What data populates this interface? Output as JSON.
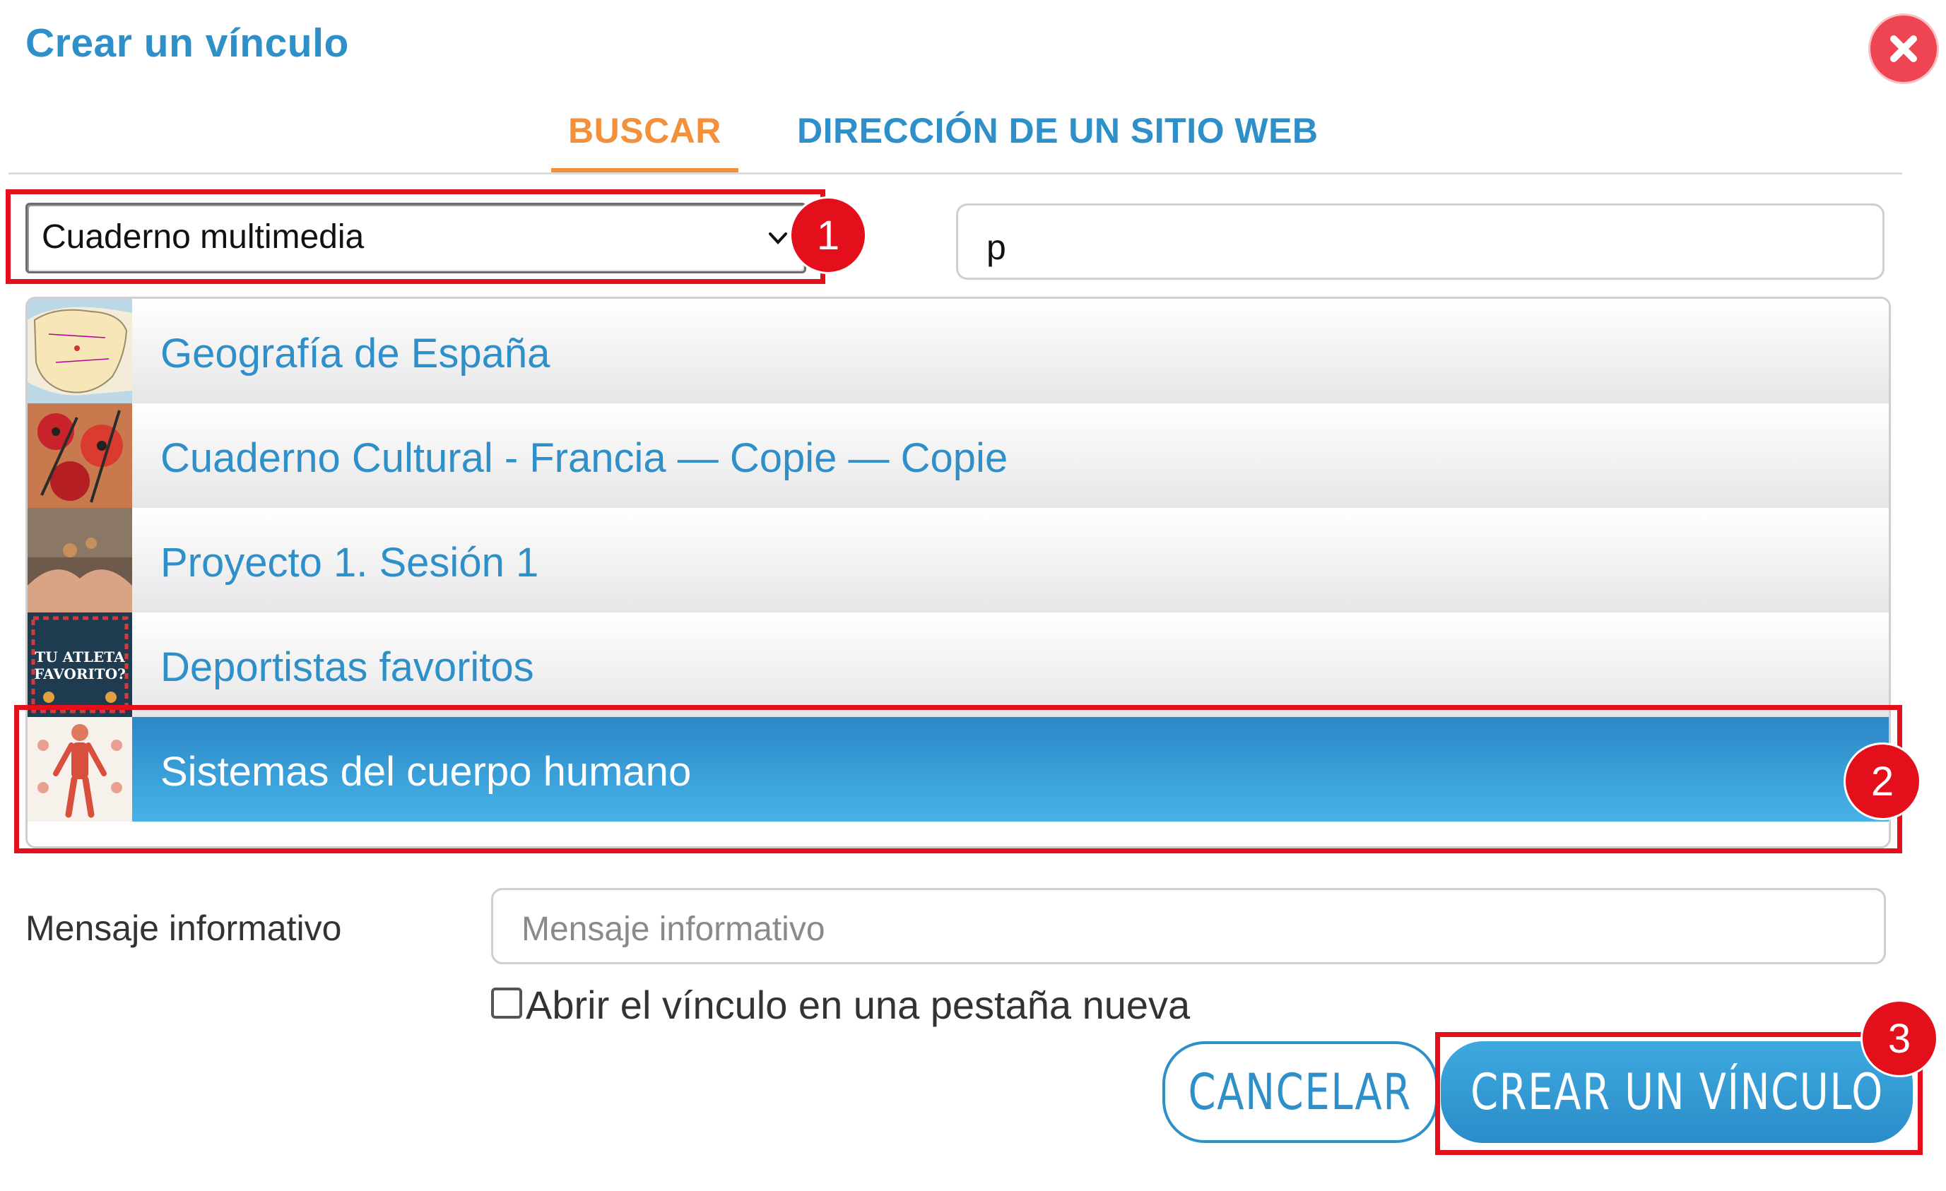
{
  "dialog": {
    "title": "Crear un vínculo",
    "close_icon": "close-icon"
  },
  "tabs": [
    {
      "label": "BUSCAR",
      "active": true
    },
    {
      "label": "DIRECCIÓN DE UN SITIO WEB",
      "active": false
    }
  ],
  "filter": {
    "selected": "Cuaderno multimedia"
  },
  "search": {
    "value": "p"
  },
  "results": [
    {
      "title": "Geografía de España",
      "thumb": "spain-map-thumbnail",
      "selected": false
    },
    {
      "title": "Cuaderno Cultural - Francia — Copie — Copie",
      "thumb": "flowers-painting-thumbnail",
      "selected": false
    },
    {
      "title": "Proyecto 1. Sesión 1",
      "thumb": "hands-thumbnail",
      "selected": false
    },
    {
      "title": "Deportistas favoritos",
      "thumb": "athlete-book-thumbnail",
      "selected": false,
      "thumb_text": "TU ATLETA FAVORITO?"
    },
    {
      "title": "Sistemas del cuerpo humano",
      "thumb": "human-body-thumbnail",
      "selected": true
    }
  ],
  "info": {
    "label": "Mensaje informativo",
    "placeholder": "Mensaje informativo"
  },
  "new_tab": {
    "label": "Abrir el vínculo en una pestaña nueva",
    "checked": false
  },
  "buttons": {
    "cancel": "CANCELAR",
    "create": "CREAR UN VÍNCULO"
  },
  "annotations": [
    "1",
    "2",
    "3"
  ],
  "colors": {
    "accent_blue": "#2f8fc9",
    "active_tab": "#f2903b",
    "highlight": "#e3101c",
    "close": "#ef4452"
  }
}
